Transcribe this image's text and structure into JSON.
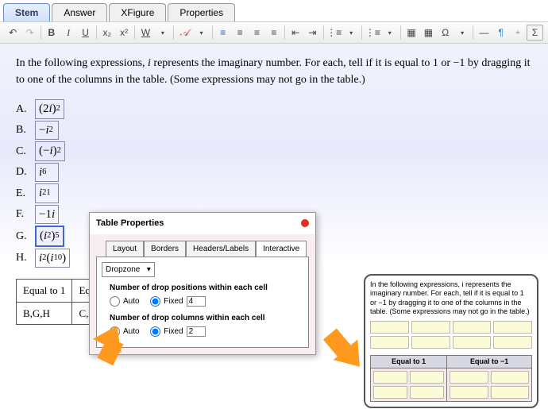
{
  "tabs": [
    "Stem",
    "Answer",
    "XFigure",
    "Properties"
  ],
  "active_tab": 0,
  "toolbar": {
    "undo": "↶",
    "redo": "↷",
    "bold": "B",
    "italic": "I",
    "underline": "U",
    "sub": "x₂",
    "sup": "x²",
    "w": "W",
    "fx": "𝒜",
    "alignL": "≡",
    "alignC": "≡",
    "alignR": "≡",
    "alignJ": "≡",
    "indent": "⇥",
    "outdent": "⇤",
    "list1": "⋮≡",
    "list2": "⋮≡",
    "tbl1": "▦",
    "tbl2": "▦",
    "omega": "Ω",
    "hr": "—",
    "pilcrow": "¶",
    "frac": "x/y",
    "sigma": "Σ"
  },
  "prompt_pre": "In the following expressions, ",
  "prompt_i": "i",
  "prompt_post": " represents the imaginary number. For each, tell if it is equal to 1 or −1 by dragging it to one of the columns in the table. (Some expressions may not go in the table.)",
  "items": [
    {
      "label": "A.",
      "expr_html": "(2<i>i</i>)<sup>2</sup>"
    },
    {
      "label": "B.",
      "expr_html": "−<i>i</i><sup>2</sup>"
    },
    {
      "label": "C.",
      "expr_html": "(−<i>i</i>)<sup>2</sup>"
    },
    {
      "label": "D.",
      "expr_html": "<i>i</i><sup>6</sup>"
    },
    {
      "label": "E.",
      "expr_html": "<i>i</i><sup>21</sup>"
    },
    {
      "label": "F.",
      "expr_html": "−1<i>i</i>"
    },
    {
      "label": "G.",
      "expr_html": "(<i>i</i><sup>2</sup>)<sup>5</sup>"
    },
    {
      "label": "H.",
      "expr_html": "<i>i</i><sup>2</sup>(<i>i</i><sup>10</sup>)"
    }
  ],
  "answer_table": {
    "headers": [
      "Equal to 1",
      "Equal to −1"
    ],
    "row": [
      "B,G,H",
      "C,D"
    ]
  },
  "popup": {
    "title": "Table Properties",
    "tabs": [
      "Layout",
      "Borders",
      "Headers/Labels",
      "Interactive"
    ],
    "active_tab": 3,
    "dropzone_label": "Dropzone",
    "group1_title": "Number of drop positions within each cell",
    "group2_title": "Number of drop columns within each cell",
    "auto": "Auto",
    "fixed": "Fixed",
    "val1": "4",
    "val2": "2"
  },
  "preview": {
    "prompt": "In the following expressions, i represents the imaginary number. For each, tell if it is equal to 1 or −1 by dragging it to one of the columns in the table. (Some expressions may not go in the table.)",
    "col1": "Equal to 1",
    "col2": "Equal to −1"
  }
}
